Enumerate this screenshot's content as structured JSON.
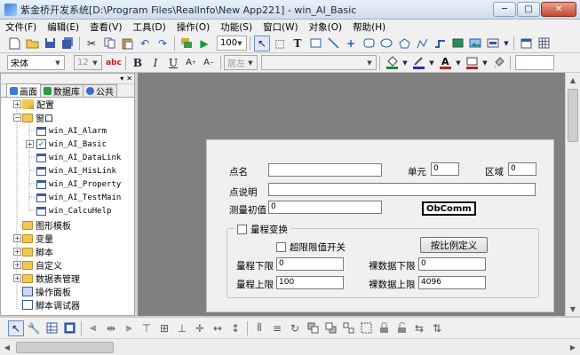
{
  "window": {
    "title": "紫金桥开发系统[D:\\Program Files\\RealInfo\\New App221] - win_AI_Basic",
    "minimize_label": "─",
    "maximize_label": "□",
    "close_label": "✕"
  },
  "menu": [
    "文件(F)",
    "编辑(E)",
    "查看(V)",
    "工具(D)",
    "操作(O)",
    "功能(S)",
    "窗口(W)",
    "对象(O)",
    "帮助(H)"
  ],
  "toolbar": {
    "zoom_value": "100",
    "font_name": "宋体",
    "font_size": "12",
    "align_value": "居左"
  },
  "left_panel": {
    "pin_glyph": "▾",
    "close_glyph": "✕",
    "tabs": [
      {
        "label": "画面",
        "color": "#3a7ad8"
      },
      {
        "label": "数据库",
        "color": "#2a9a4a"
      },
      {
        "label": "公共",
        "color": "#3a6ac8"
      }
    ],
    "tree": [
      {
        "label": "配置",
        "type": "folder-key",
        "expand": "+"
      },
      {
        "label": "窗口",
        "type": "folder",
        "expand": "−"
      },
      {
        "label": "win_AI_Alarm",
        "type": "win"
      },
      {
        "label": "win_AI_Basic",
        "type": "win-checked",
        "expand": "+"
      },
      {
        "label": "win_AI_DataLink",
        "type": "win"
      },
      {
        "label": "win_AI_HisLink",
        "type": "win"
      },
      {
        "label": "win_AI_Property",
        "type": "win"
      },
      {
        "label": "win_AI_TestMain",
        "type": "win"
      },
      {
        "label": "win_CalcuHelp",
        "type": "win"
      },
      {
        "label": "图形模板",
        "type": "folder"
      },
      {
        "label": "变量",
        "type": "folder",
        "expand": "+"
      },
      {
        "label": "脚本",
        "type": "folder",
        "expand": "+"
      },
      {
        "label": "自定义",
        "type": "folder",
        "expand": "+"
      },
      {
        "label": "数据表管理",
        "type": "folder",
        "expand": "+"
      },
      {
        "label": "操作面板",
        "type": "panel"
      },
      {
        "label": "脚本调试器",
        "type": "panel"
      }
    ]
  },
  "form": {
    "point_name_label": "点名",
    "point_name_value": "",
    "unit_label": "单元",
    "unit_value": "0",
    "area_label": "区域",
    "area_value": "0",
    "desc_label": "点说明",
    "desc_value": "",
    "init_label": "测量初值",
    "init_value": "0",
    "obcomm_label": "ObComm",
    "range_group_label": "量程变换",
    "limit_checkbox_label": "超限限值开关",
    "scale_button_label": "按比例定义",
    "range_low_label": "量程下限",
    "range_low_value": "0",
    "raw_low_label": "裸数据下限",
    "raw_low_value": "0",
    "range_high_label": "量程上限",
    "range_high_value": "100",
    "raw_high_label": "裸数据上限",
    "raw_high_value": "4096"
  }
}
